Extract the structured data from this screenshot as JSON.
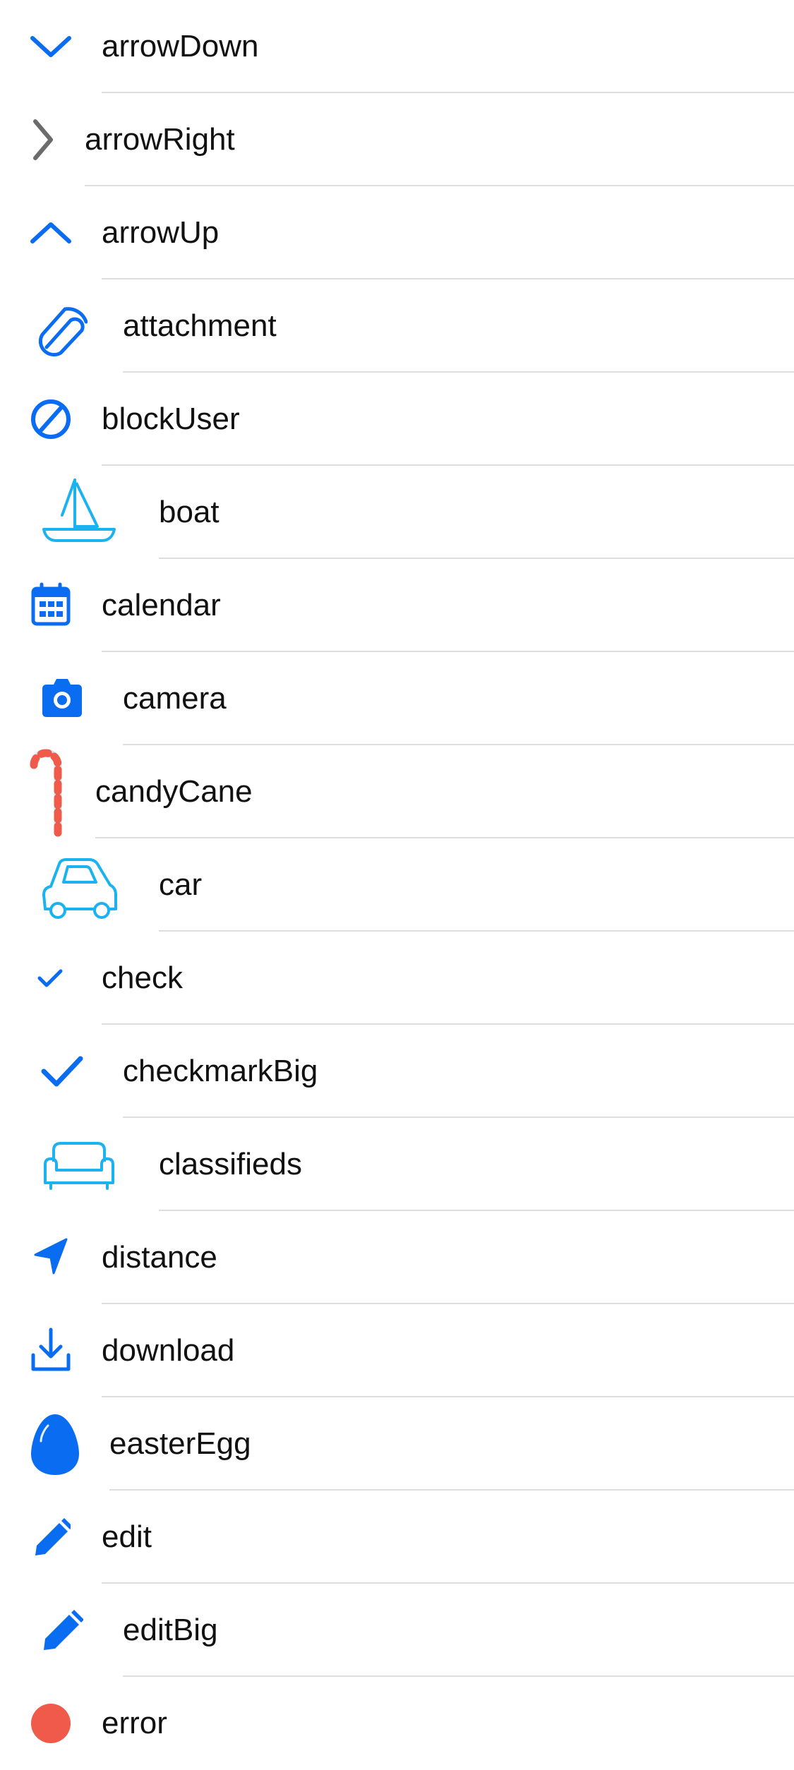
{
  "colors": {
    "accent": "#0a6cf0",
    "cyan": "#1ab3ef",
    "gray": "#6b6b6b",
    "red": "#f05a4a",
    "stripe": "#c9e6ee",
    "separator": "#dedede",
    "text": "#111111"
  },
  "icons": {
    "items": [
      {
        "label": "arrowDown",
        "icon": "chevron-down-icon"
      },
      {
        "label": "arrowRight",
        "icon": "chevron-right-icon"
      },
      {
        "label": "arrowUp",
        "icon": "chevron-up-icon"
      },
      {
        "label": "attachment",
        "icon": "paperclip-icon"
      },
      {
        "label": "blockUser",
        "icon": "block-icon"
      },
      {
        "label": "boat",
        "icon": "sailboat-icon"
      },
      {
        "label": "calendar",
        "icon": "calendar-icon"
      },
      {
        "label": "camera",
        "icon": "camera-icon"
      },
      {
        "label": "candyCane",
        "icon": "candy-cane-icon"
      },
      {
        "label": "car",
        "icon": "car-icon"
      },
      {
        "label": "check",
        "icon": "check-icon"
      },
      {
        "label": "checkmarkBig",
        "icon": "checkmark-big-icon"
      },
      {
        "label": "classifieds",
        "icon": "sofa-icon"
      },
      {
        "label": "distance",
        "icon": "location-arrow-icon"
      },
      {
        "label": "download",
        "icon": "download-icon"
      },
      {
        "label": "easterEgg",
        "icon": "egg-icon"
      },
      {
        "label": "edit",
        "icon": "pencil-icon"
      },
      {
        "label": "editBig",
        "icon": "pencil-big-icon"
      },
      {
        "label": "error",
        "icon": "error-icon"
      }
    ]
  }
}
